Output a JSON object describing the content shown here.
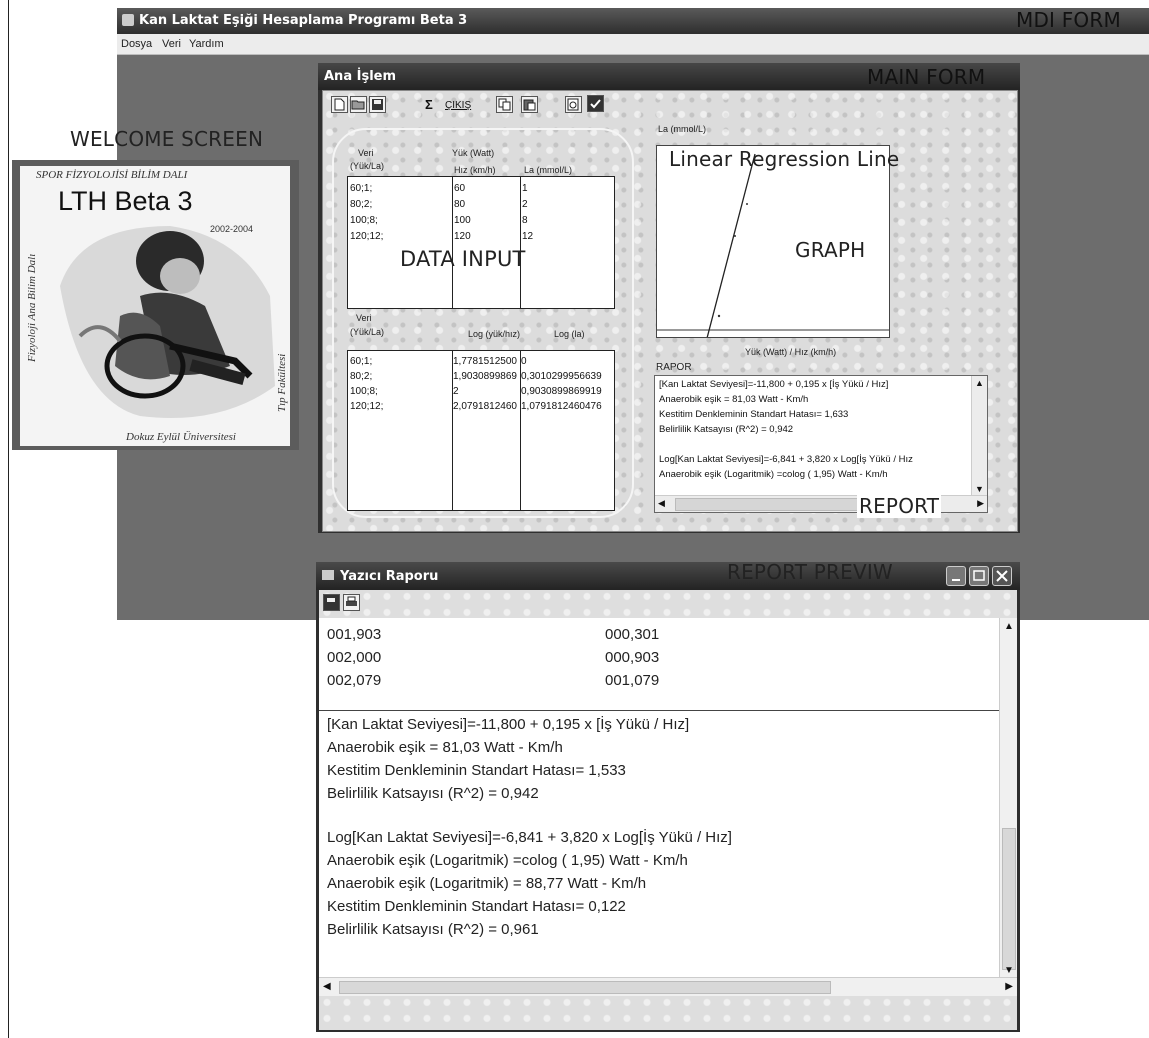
{
  "callouts": {
    "mdi_form": "MDI FORM",
    "main_form": "MAIN FORM",
    "welcome_screen": "WELCOME SCREEN",
    "linear_regression": "Linear Regression Line",
    "graph": "GRAPH",
    "data_input": "DATA INPUT",
    "report": "REPORT",
    "report_preview": "REPORT PREVIW"
  },
  "mdi": {
    "title": "Kan Laktat Eşiği Hesaplama Programı Beta 3",
    "menu": [
      "Dosya",
      "Veri",
      "Yardım"
    ]
  },
  "welcome": {
    "department": "SPOR FİZYOLOJİSİ BİLİM DALI",
    "product": "LTH Beta 3",
    "years": "2002-2004",
    "left_vertical": "Fizyoloji Ana Bilim Dalı",
    "right_vertical": "Tıp Fakültesi",
    "university": "Dokuz Eylül Üniversitesi"
  },
  "main_form": {
    "title": "Ana İşlem",
    "toolbar": {
      "exit_label": "ÇIKIŞ",
      "sum_glyph": "Σ"
    },
    "input_table": {
      "left_header_1": "Veri",
      "left_header_2": "(Yük/La)",
      "yuk_header": "Yük  (Watt)",
      "hiz_header": "Hız  (km/h)",
      "la_header": "La  (mmol/L)",
      "rows": [
        {
          "veri": "60;1;",
          "yuk": "60",
          "la": "1"
        },
        {
          "veri": "80;2;",
          "yuk": "80",
          "la": "2"
        },
        {
          "veri": "100;8;",
          "yuk": "100",
          "la": "8"
        },
        {
          "veri": "120;12;",
          "yuk": "120",
          "la": "12"
        }
      ]
    },
    "log_table": {
      "left_header_1": "Veri",
      "left_header_2": "(Yük/La)",
      "log_yuk_header": "Log (yük/hız)",
      "log_la_header": "Log (la)",
      "rows": [
        {
          "veri": "60;1;",
          "log_yuk": "1,7781512500",
          "log_la": "0"
        },
        {
          "veri": "80;2;",
          "log_yuk": "1,9030899869",
          "log_la": "0,3010299956639"
        },
        {
          "veri": "100;8;",
          "log_yuk": "2",
          "log_la": "0,9030899869919"
        },
        {
          "veri": "120;12;",
          "log_yuk": "2,0791812460",
          "log_la": "1,0791812460476"
        }
      ]
    },
    "graph": {
      "ylabel": "La  (mmol/L)",
      "xlabel": "Yük  (Watt)  / Hız  (km/h)"
    },
    "report_label": "RAPOR",
    "report_lines": [
      "[Kan Laktat Seviyesi]=-11,800 + 0,195 x [İş Yükü / Hız]",
      "Anaerobik eşik = 81,03 Watt - Km/h",
      "Kestitim Denkleminin Standart Hatası= 1,633",
      "Belirlilik Katsayısı  (R^2)  = 0,942",
      "",
      "Log[Kan Laktat Seviyesi]=-6,841 + 3,820 x Log[İş Yükü / Hız",
      "Anaerobik eşik  (Logaritmik)  =colog  ( 1,95)  Watt - Km/h"
    ]
  },
  "preview": {
    "title": "Yazıcı Raporu",
    "values_rows": [
      {
        "a": "001,903",
        "b": "000,301"
      },
      {
        "a": "002,000",
        "b": "000,903"
      },
      {
        "a": "002,079",
        "b": "001,079"
      }
    ],
    "lines": [
      "[Kan Laktat Seviyesi]=-11,800 + 0,195 x [İş Yükü / Hız]",
      "Anaerobik eşik = 81,03 Watt - Km/h",
      "Kestitim Denkleminin Standart Hatası= 1,533",
      "Belirlilik Katsayısı  (R^2)  = 0,942",
      "",
      "Log[Kan Laktat Seviyesi]=-6,841 + 3,820 x Log[İş Yükü / Hız]",
      "Anaerobik eşik  (Logaritmik)  =colog  ( 1,95)  Watt - Km/h",
      "Anaerobik eşik  (Logaritmik)  = 88,77 Watt - Km/h",
      "Kestitim Denkleminin Standart Hatası= 0,122",
      "Belirlilik Katsayısı  (R^2)  = 0,961"
    ]
  }
}
